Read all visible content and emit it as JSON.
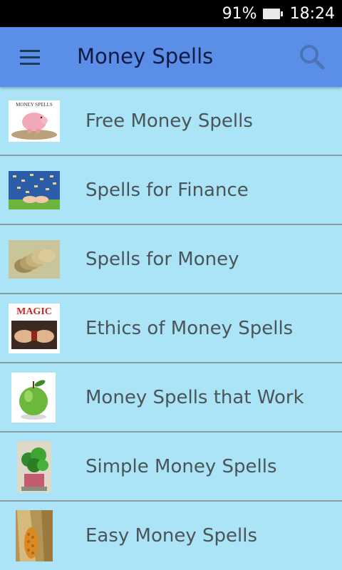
{
  "status_bar": {
    "battery_percent": "91%",
    "time": "18:24",
    "icons": [
      "battery-icon"
    ]
  },
  "app_bar": {
    "title": "Money Spells",
    "menu_icon": "hamburger-menu-icon",
    "search_icon": "search-icon",
    "background": "#5b8ee6"
  },
  "list": {
    "background": "#abe3f7",
    "items": [
      {
        "label": "Free Money Spells",
        "thumbnail": "piggy-bank-image",
        "thumb_text": "MONEY SPELLS"
      },
      {
        "label": "Spells for Finance",
        "thumbnail": "money-rain-hands-image"
      },
      {
        "label": "Spells for Money",
        "thumbnail": "coins-stack-image"
      },
      {
        "label": "Ethics of Money Spells",
        "thumbnail": "magic-hands-image",
        "thumb_text": "MAGIC"
      },
      {
        "label": "Money Spells that Work",
        "thumbnail": "green-apple-image"
      },
      {
        "label": "Simple Money Spells",
        "thumbnail": "potted-plant-image"
      },
      {
        "label": "Easy Money Spells",
        "thumbnail": "corn-cob-image"
      }
    ]
  }
}
